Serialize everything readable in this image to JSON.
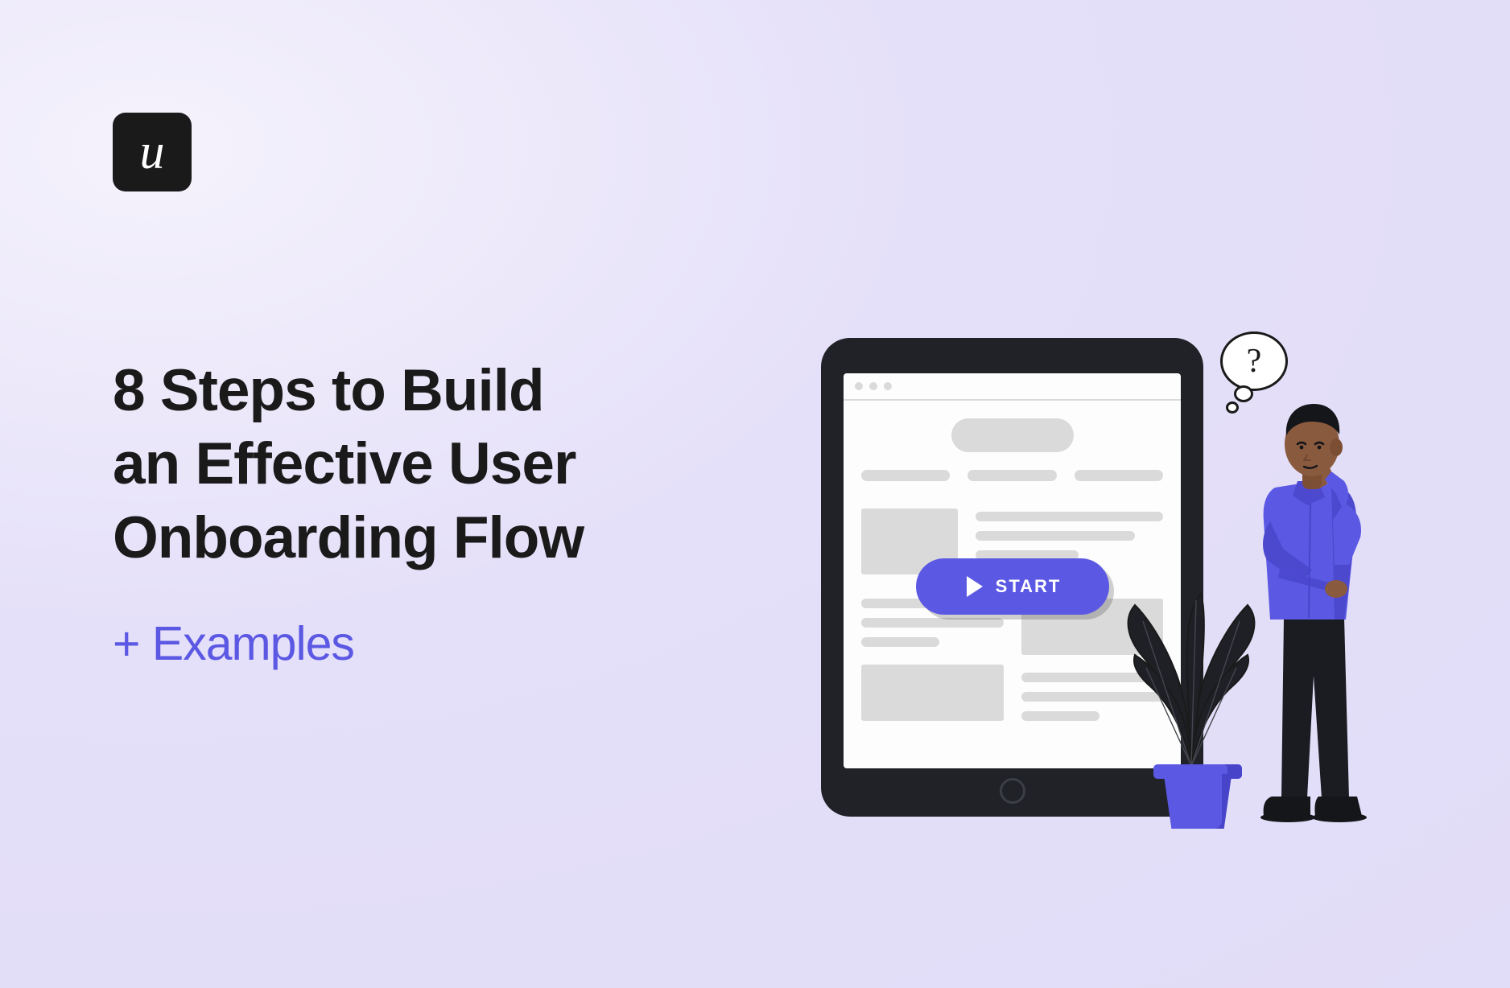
{
  "logo": {
    "letter": "u"
  },
  "headline": {
    "line1": "8 Steps to Build",
    "line2": "an Effective User",
    "line3": "Onboarding Flow",
    "subtitle": "+ Examples"
  },
  "illustration": {
    "start_button_label": "START",
    "bubble_text": "?"
  },
  "colors": {
    "accent": "#5b58e3",
    "text": "#1a1a1a",
    "bg_light": "#e5e0f9"
  }
}
